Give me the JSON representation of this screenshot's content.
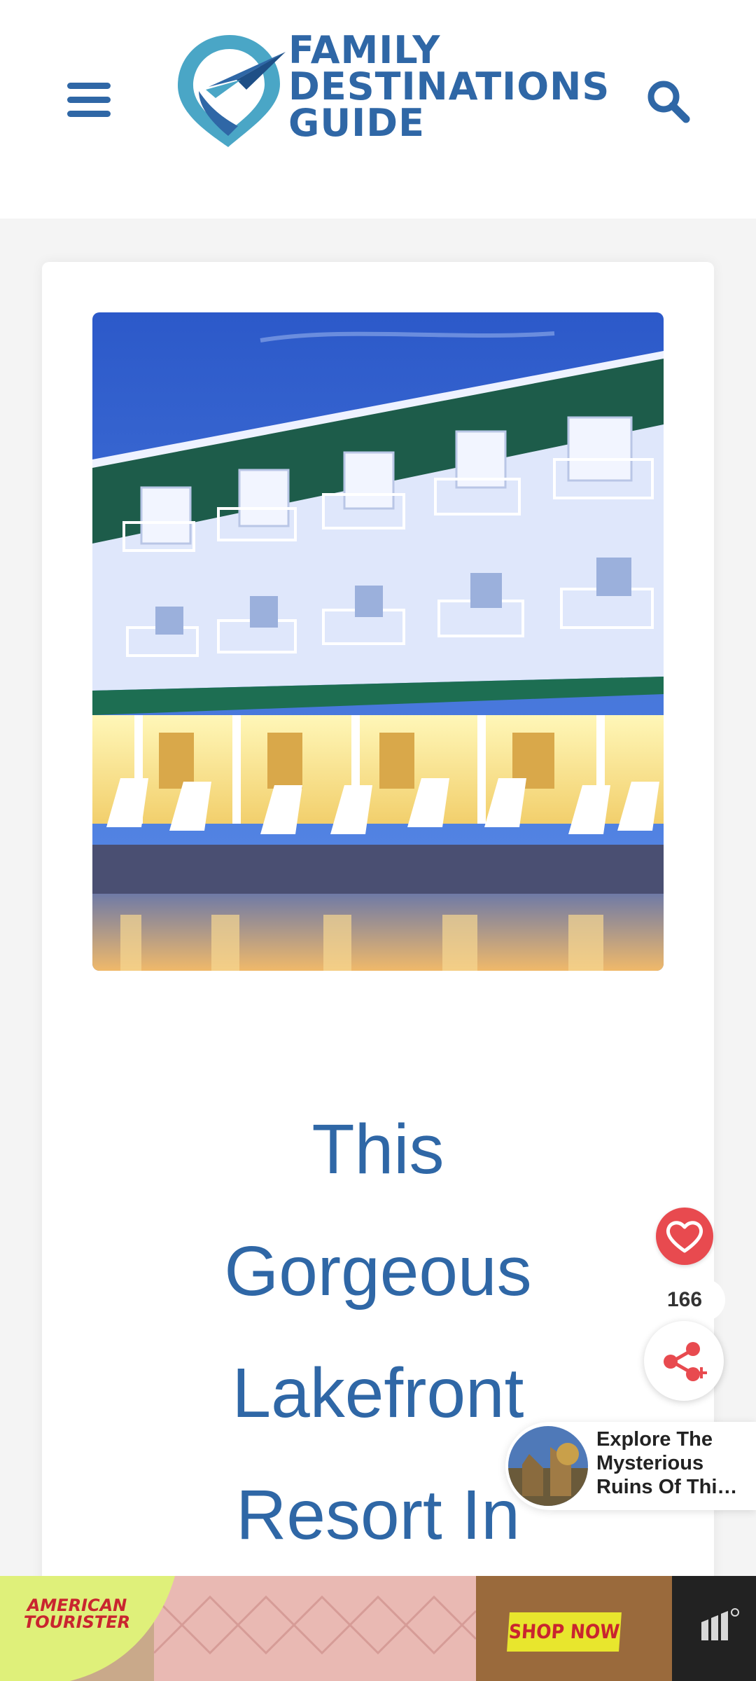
{
  "header": {
    "menu_icon": "hamburger-menu-icon",
    "logo": {
      "lines": [
        "FAMILY",
        "DESTINATIONS",
        "GUIDE"
      ],
      "icon": "location-pin-paper-plane-icon"
    },
    "search_icon": "search-icon",
    "brand_color": "#2f67a6"
  },
  "article": {
    "hero_image": "lakefront-resort-photo",
    "title_lines": [
      "This",
      "Gorgeous",
      "Lakefront",
      "Resort In"
    ]
  },
  "social": {
    "heart_icon": "heart-icon",
    "share_count": "166",
    "share_icon": "share-icon",
    "heart_color": "#e84a4f"
  },
  "promo": {
    "lines": [
      "Explore The",
      "Mysterious",
      "Ruins Of Thi…"
    ]
  },
  "ad": {
    "brand": "AMERICAN TOURISTER",
    "cta": "SHOP NOW",
    "network_icon": "mediavine-logo-icon"
  }
}
